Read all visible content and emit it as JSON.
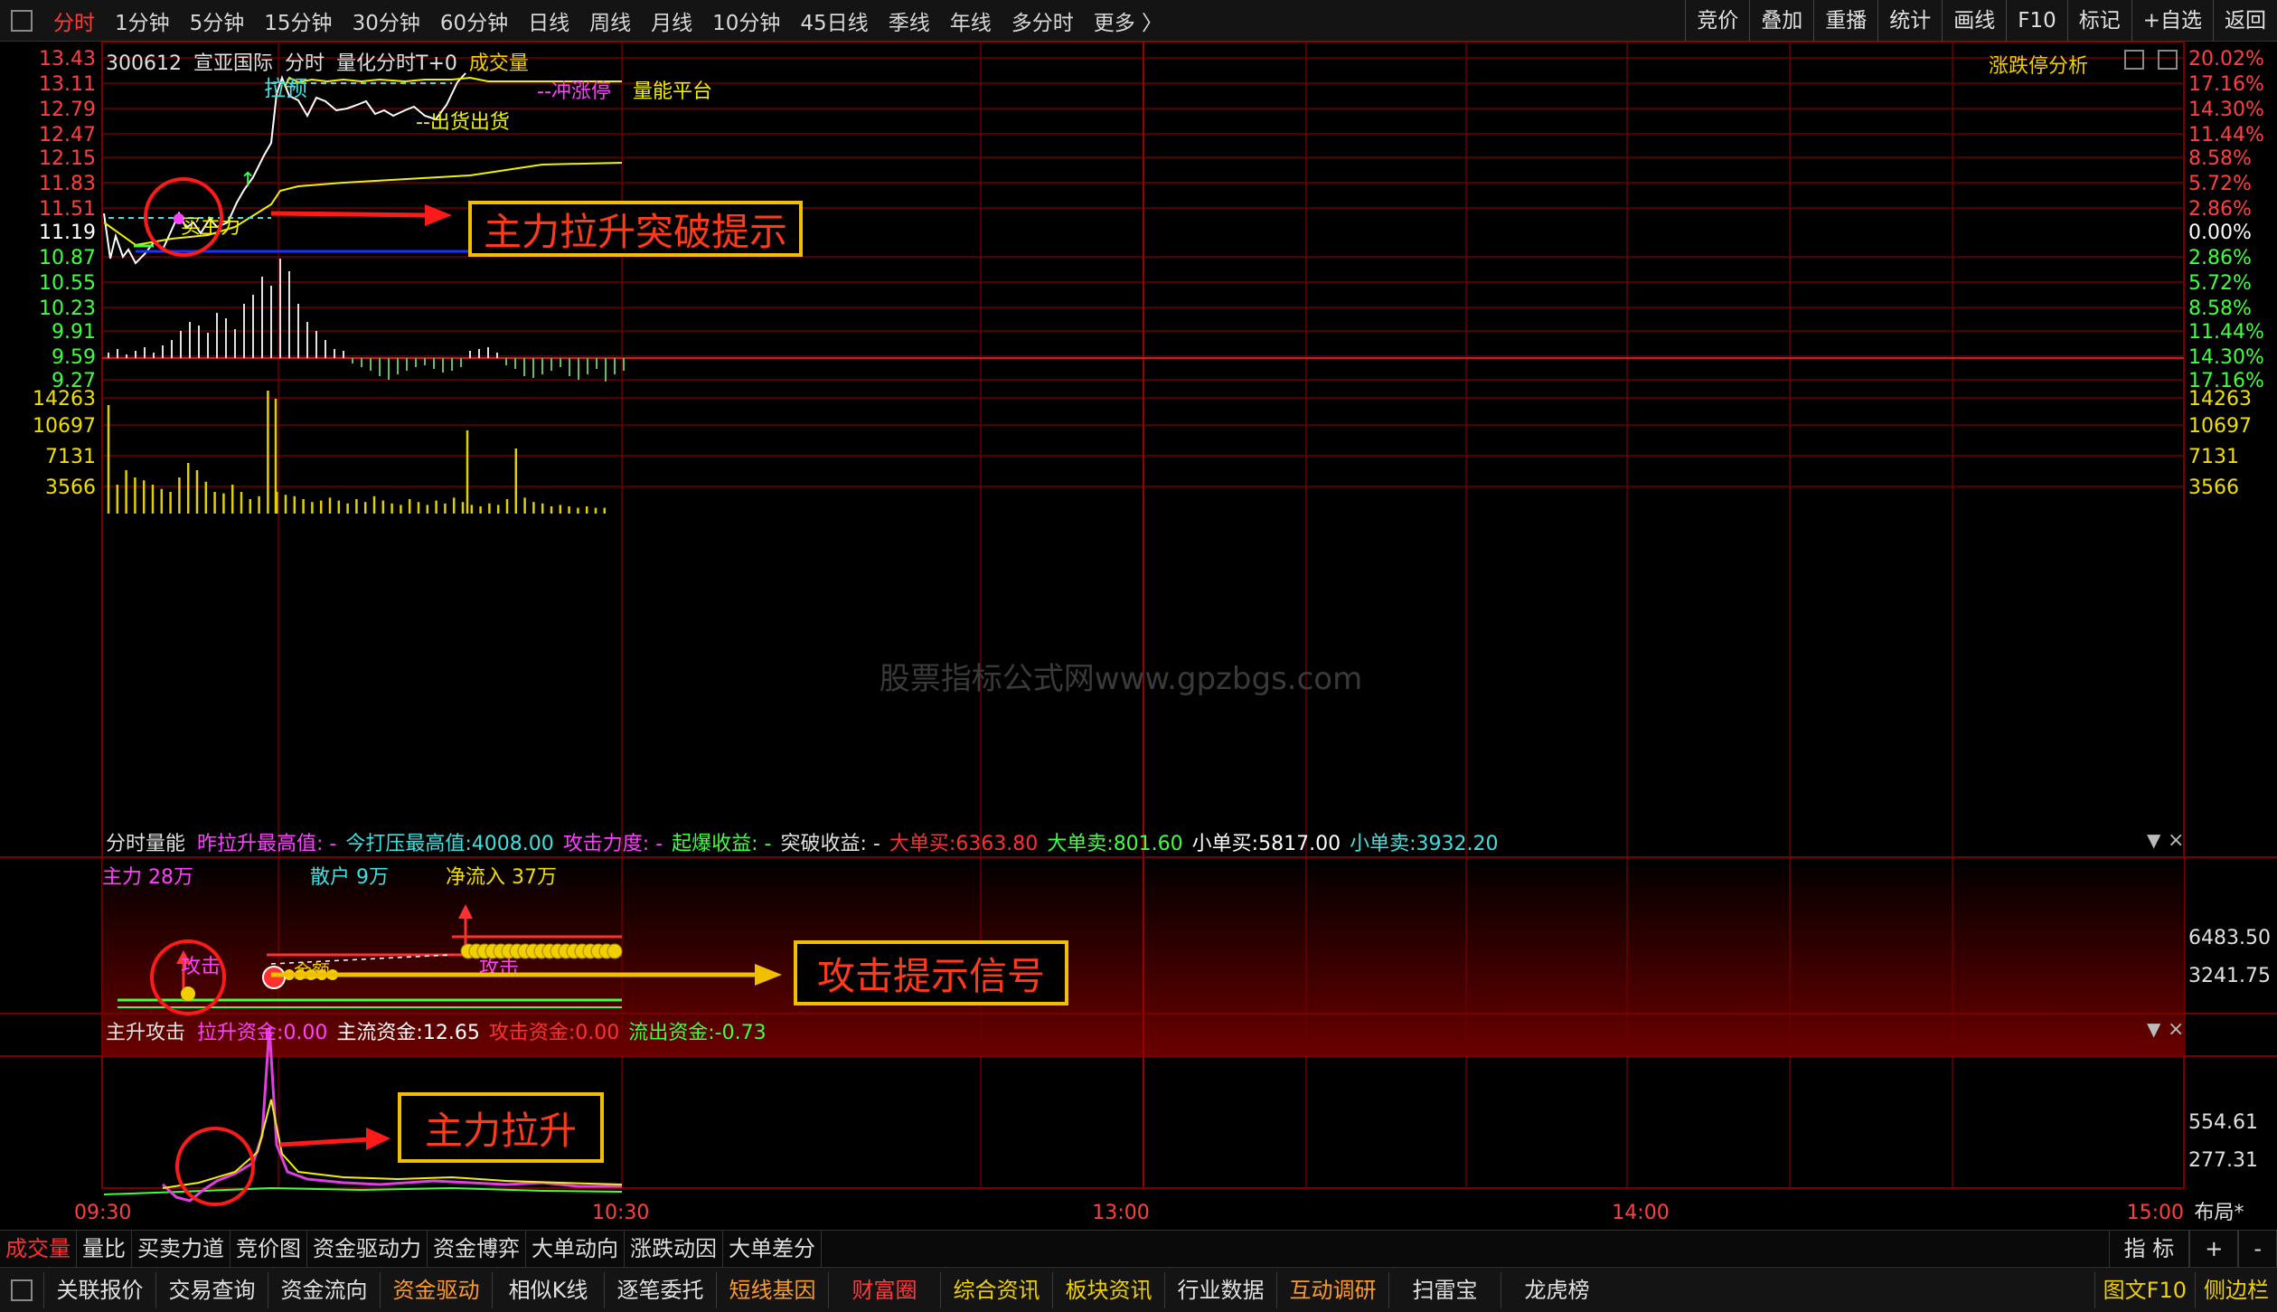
{
  "toolbar": {
    "timeframes": [
      "分时",
      "1分钟",
      "5分钟",
      "15分钟",
      "30分钟",
      "60分钟",
      "日线",
      "周线",
      "月线",
      "10分钟",
      "45日线",
      "季线",
      "年线",
      "多分时",
      "更多 〉"
    ],
    "active_index": 0,
    "right_buttons": [
      "竞价",
      "叠加",
      "重播",
      "统计",
      "画线",
      "F10",
      "标记",
      "+自选",
      "返回"
    ]
  },
  "main_chart": {
    "code": "300612",
    "name": "宣亚国际",
    "mode": "分时",
    "indicator": "量化分时T+0",
    "volume_label": "成交量",
    "analysis_button": "涨跌停分析",
    "price_labels": [
      "13.43",
      "13.11",
      "12.79",
      "12.47",
      "12.15",
      "11.83",
      "11.51",
      "11.19",
      "10.87",
      "10.55",
      "10.23",
      "9.91",
      "9.59",
      "9.27"
    ],
    "pct_labels": [
      "20.02%",
      "17.16%",
      "14.30%",
      "11.44%",
      "8.58%",
      "5.72%",
      "2.86%",
      "0.00%",
      "2.86%",
      "5.72%",
      "8.58%",
      "11.44%",
      "14.30%",
      "17.16%"
    ],
    "chart_texts": {
      "pull": "拉预",
      "limit_up": "--冲涨停",
      "platform": "量能平台",
      "sell": "--出货出货",
      "buy": "买主力"
    },
    "volume_labels": [
      "14263",
      "10697",
      "7131",
      "3566"
    ],
    "watermark": "股票指标公式网www.gpzbgs.com"
  },
  "annotations": {
    "breakout": "主力拉升突破提示",
    "attack": "攻击提示信号",
    "pull": "主力拉升"
  },
  "panel1": {
    "title": "分时量能",
    "metrics": [
      {
        "label": "昨拉升最高值:",
        "value": " -",
        "color": "#ff40ff"
      },
      {
        "label": "今打压最高值:",
        "value": "4008.00",
        "color": "#40e0e0"
      },
      {
        "label": "攻击力度:",
        "value": " -",
        "color": "#ff40ff"
      },
      {
        "label": "起爆收益:",
        "value": " -",
        "color": "#40ff40"
      },
      {
        "label": "突破收益:",
        "value": " -",
        "color": "#e0e0e0"
      },
      {
        "label": "大单买:",
        "value": "6363.80",
        "color": "#ff3030"
      },
      {
        "label": "大单卖:",
        "value": "801.60",
        "color": "#40ff40"
      },
      {
        "label": "小单买:",
        "value": "5817.00",
        "color": "#ffffff"
      },
      {
        "label": "小单卖:",
        "value": "3932.20",
        "color": "#40e0e0"
      }
    ],
    "sub": [
      {
        "text": "主力 28万",
        "color": "#ff40ff"
      },
      {
        "text": "散户 9万",
        "color": "#40e0e0"
      },
      {
        "text": "净流入 37万",
        "color": "#f0e000"
      }
    ],
    "axis": [
      "6483.50",
      "3241.75"
    ],
    "chart_texts": {
      "attack": "攻击",
      "attack2": "攻击",
      "gold": "金额"
    }
  },
  "panel2": {
    "title": "主升攻击",
    "metrics": [
      {
        "label": "拉升资金:",
        "value": "0.00",
        "color": "#ff40ff"
      },
      {
        "label": "主流资金:",
        "value": "12.65",
        "color": "#ffffff"
      },
      {
        "label": "攻击资金:",
        "value": "0.00",
        "color": "#ff3030"
      },
      {
        "label": "流出资金:",
        "value": "-0.73",
        "color": "#40ff40"
      }
    ],
    "axis": [
      "554.61",
      "277.31"
    ]
  },
  "time_axis": {
    "labels": [
      "09:30",
      "10:30",
      "13:00",
      "14:00",
      "15:00"
    ],
    "layout_btn": "布局*"
  },
  "tabs": {
    "items": [
      "成交量",
      "量比",
      "买卖力道",
      "竞价图",
      "资金驱动力",
      "资金博弈",
      "大单动向",
      "涨跌动因",
      "大单差分"
    ],
    "active_index": 0,
    "right": [
      "指 标",
      "+",
      "-"
    ]
  },
  "bottom": {
    "items": [
      {
        "label": "关联报价",
        "style": ""
      },
      {
        "label": "交易查询",
        "style": ""
      },
      {
        "label": "资金流向",
        "style": ""
      },
      {
        "label": "资金驱动",
        "style": "orange"
      },
      {
        "label": "相似K线",
        "style": ""
      },
      {
        "label": "逐笔委托",
        "style": ""
      },
      {
        "label": "短线基因",
        "style": "orange"
      },
      {
        "label": "财富圈",
        "style": "red"
      },
      {
        "label": "综合资讯",
        "style": "yellow"
      },
      {
        "label": "板块资讯",
        "style": "yellow"
      },
      {
        "label": "行业数据",
        "style": ""
      },
      {
        "label": "互动调研",
        "style": "orange"
      },
      {
        "label": "扫雷宝",
        "style": ""
      },
      {
        "label": "龙虎榜",
        "style": ""
      }
    ],
    "right": [
      "图文F10",
      "侧边栏"
    ]
  },
  "colors": {
    "grid": "#7a0000",
    "price_line": "#ffffff",
    "avg_line": "#f0f000",
    "accent": "#ff3030"
  }
}
